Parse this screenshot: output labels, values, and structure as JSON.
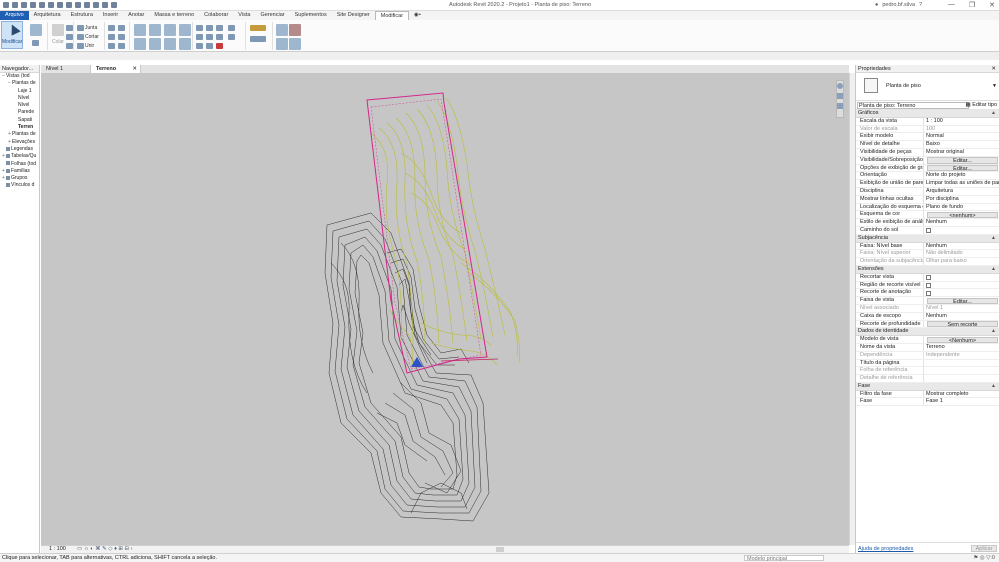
{
  "app": {
    "title": "Autodesk Revit 2020.2 - Projeto1 - Planta de piso: Terreno",
    "user": "pedro.bf.silva",
    "window_controls": [
      "—",
      "❐",
      "✕"
    ]
  },
  "ribbon_tabs": [
    "Arquivo",
    "Arquitetura",
    "Estrutura",
    "Inserir",
    "Anotar",
    "Massa e terreno",
    "Colaborar",
    "Vista",
    "Gerenciar",
    "Suplementos",
    "Site Designer",
    "Modificar",
    "◉•"
  ],
  "ribbon": {
    "modify_label": "Modificar",
    "tools": {
      "join": "Junta",
      "cut": "Cortar",
      "unite": "Unir",
      "paste": "Colar"
    }
  },
  "browser": {
    "title": "Navegador...",
    "items": [
      {
        "label": "Vistas (tod",
        "level": 0,
        "exp": "−"
      },
      {
        "label": "Plantas de",
        "level": 1,
        "exp": "−"
      },
      {
        "label": "Laje 1",
        "level": 2,
        "exp": ""
      },
      {
        "label": "Nível",
        "level": 2,
        "exp": ""
      },
      {
        "label": "Nível",
        "level": 2,
        "exp": ""
      },
      {
        "label": "Parede",
        "level": 2,
        "exp": ""
      },
      {
        "label": "Sapati",
        "level": 2,
        "exp": ""
      },
      {
        "label": "Terren",
        "level": 2,
        "exp": "",
        "selected": true
      },
      {
        "label": "Plantas de",
        "level": 1,
        "exp": "+"
      },
      {
        "label": "Elevações",
        "level": 1,
        "exp": "+"
      },
      {
        "label": "Legendas",
        "level": 0,
        "exp": "",
        "icon": true
      },
      {
        "label": "Tabelas/Qu",
        "level": 0,
        "exp": "+",
        "icon": true
      },
      {
        "label": "Folhas (tod",
        "level": 0,
        "exp": "",
        "icon": true
      },
      {
        "label": "Famílias",
        "level": 0,
        "exp": "+",
        "icon": true
      },
      {
        "label": "Grupos",
        "level": 0,
        "exp": "+",
        "icon": true
      },
      {
        "label": "Vínculos d",
        "level": 0,
        "exp": "",
        "icon": true
      }
    ]
  },
  "view_tabs": [
    {
      "label": "Nível 1",
      "active": false
    },
    {
      "label": "Terreno",
      "active": true
    }
  ],
  "view_control": {
    "scale": "1 : 100",
    "icons": "▭ ☼ ◐ ⌘ ✎ ◇ ♦ ⊞ ⊟ ‹"
  },
  "properties": {
    "title": "Propriedades",
    "type_name": "Planta de piso",
    "instance_selector": "Planta de piso: Terreno",
    "edit_type": "Editar tipo",
    "sections": [
      {
        "name": "Gráficos",
        "rows": [
          {
            "name": "Escala da vista",
            "value": "1 : 100"
          },
          {
            "name": "Valor de escala",
            "mid": "1:",
            "value": "100",
            "disabled": true
          },
          {
            "name": "Exibir modelo",
            "value": "Normal"
          },
          {
            "name": "Nível de detalhe",
            "value": "Baixo"
          },
          {
            "name": "Visibilidade de peças",
            "value": "Mostrar original"
          },
          {
            "name": "Visibilidade/Sobreposição de ...",
            "button": "Editar..."
          },
          {
            "name": "Opções de exibição de gráficos",
            "button": "Editar..."
          },
          {
            "name": "Orientação",
            "value": "Norte do projeto"
          },
          {
            "name": "Exibição de união de parede",
            "value": "Limpar todas as uniões de pare..."
          },
          {
            "name": "Disciplina",
            "value": "Arquitetura"
          },
          {
            "name": "Mostrar linhas ocultas",
            "value": "Por disciplina"
          },
          {
            "name": "Localização do esquema de cor",
            "value": "Plano de fundo"
          },
          {
            "name": "Esquema de cor",
            "button": "<nenhum>"
          },
          {
            "name": "Estilo de exibição de análise p...",
            "value": "Nenhum"
          },
          {
            "name": "Caminho do sol",
            "checkbox": true
          }
        ]
      },
      {
        "name": "Subjacência",
        "rows": [
          {
            "name": "Faixa: Nível base",
            "value": "Nenhum"
          },
          {
            "name": "Faixa: Nível superior",
            "value": "Não delimitado",
            "disabled": true
          },
          {
            "name": "Orientação da subjacência",
            "value": "Olhar para baixo",
            "disabled": true
          }
        ]
      },
      {
        "name": "Extensões",
        "rows": [
          {
            "name": "Recortar vista",
            "checkbox": true
          },
          {
            "name": "Região de recorte visível",
            "checkbox": true
          },
          {
            "name": "Recorte de anotação",
            "checkbox": true
          },
          {
            "name": "Faixa de vista",
            "button": "Editar..."
          },
          {
            "name": "Nível associado",
            "value": "Nível 1",
            "disabled": true
          },
          {
            "name": "Caixa de escopo",
            "value": "Nenhum"
          },
          {
            "name": "Recorte de profundidade",
            "button": "Sem recorte"
          }
        ]
      },
      {
        "name": "Dados de identidade",
        "rows": [
          {
            "name": "Modelo de vista",
            "button": "<Nenhum>"
          },
          {
            "name": "Nome da vista",
            "value": "Terreno"
          },
          {
            "name": "Dependência",
            "value": "Independente",
            "disabled": true
          },
          {
            "name": "Título da página",
            "value": ""
          },
          {
            "name": "Folha de referência",
            "value": "",
            "disabled": true
          },
          {
            "name": "Detalhe de referência",
            "value": "",
            "disabled": true
          }
        ]
      },
      {
        "name": "Fase",
        "rows": [
          {
            "name": "Filtro da fase",
            "value": "Mostrar completo"
          },
          {
            "name": "Fase",
            "value": "Fase 1"
          }
        ]
      }
    ],
    "help_link": "Ajuda de propriedades",
    "apply_button": "Aplicar"
  },
  "status": {
    "message": "Clique para selecionar, TAB para alternativas, CTRL adiciona, SHIFT cancela a seleção.",
    "model": "Modelo principal",
    "right_icons": "⚑ ◎ ▽:0"
  },
  "colors": {
    "file_tab": "#1e5fb4",
    "canvas_bg": "#c6c6c6",
    "contour_yellow": "#b9bd2c",
    "boundary_magenta": "#d4268a",
    "contour_black": "#1a1a1a"
  }
}
